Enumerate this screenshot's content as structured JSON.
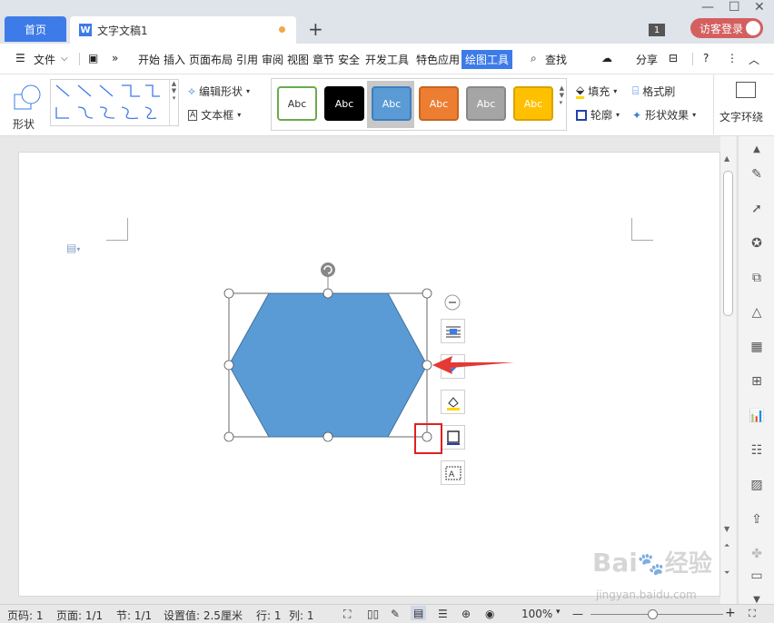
{
  "tabs": {
    "home": "首页",
    "doc_title": "文字文稿1",
    "badge": "1",
    "login": "访客登录"
  },
  "menu": {
    "file": "文件",
    "items": [
      "开始",
      "插入",
      "页面布局",
      "引用",
      "审阅",
      "视图",
      "章节",
      "安全",
      "开发工具",
      "特色应用"
    ],
    "active": "绘图工具",
    "search": "查找",
    "share": "分享"
  },
  "ribbon": {
    "shape": "形状",
    "edit_shape": "编辑形状",
    "textbox": "文本框",
    "style_label": "Abc",
    "fill": "填充",
    "format_brush": "格式刷",
    "outline": "轮廓",
    "shape_effect": "形状效果",
    "text_wrap": "文字环绕",
    "swatches": [
      {
        "bg": "#ffffff",
        "border": "#6aab4b",
        "fg": "#333333"
      },
      {
        "bg": "#000000",
        "border": "#000000",
        "fg": "#ffffff"
      },
      {
        "bg": "#5b9bd5",
        "border": "#3d7fbf",
        "fg": "#ffffff"
      },
      {
        "bg": "#ed7d31",
        "border": "#c56420",
        "fg": "#ffffff"
      },
      {
        "bg": "#a5a5a5",
        "border": "#888888",
        "fg": "#ffffff"
      },
      {
        "bg": "#ffc000",
        "border": "#d9a300",
        "fg": "#ffffff"
      }
    ]
  },
  "shape": {
    "fill": "#5b9bd5",
    "stroke": "#41719c",
    "type": "hexagon"
  },
  "status": {
    "page": "页码: 1",
    "pages": "页面: 1/1",
    "section": "节: 1/1",
    "setting": "设置值: 2.5厘米",
    "row": "行: 1",
    "col": "列: 1",
    "zoom": "100%"
  },
  "watermark": {
    "line1": "Bai",
    "line2": "经验",
    "url": "jingyan.baidu.com"
  },
  "colors": {
    "accent": "#3d7be8",
    "highlight_box": "#e02020",
    "arrow": "#e53935"
  }
}
